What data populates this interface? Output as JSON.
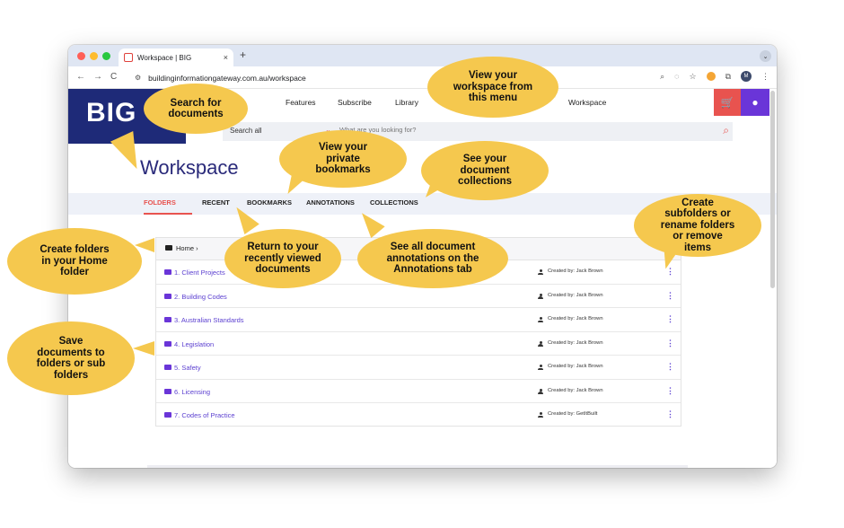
{
  "browser": {
    "tab_title": "Workspace | BIG",
    "tab_close": "×",
    "new_tab": "+",
    "tab_menu": "⌄",
    "nav_back": "←",
    "nav_forward": "→",
    "nav_reload": "C",
    "url": "buildinginformationgateway.com.au/workspace",
    "profile_initial": "M"
  },
  "site": {
    "logo": "BIG",
    "nav": [
      "Features",
      "Subscribe",
      "Library",
      "Workspace"
    ],
    "search": {
      "scope": "Search all",
      "placeholder": "What are you looking for?"
    }
  },
  "workspace": {
    "title": "Workspace",
    "tabs": [
      "FOLDERS",
      "RECENT",
      "BOOKMARKS",
      "ANNOTATIONS",
      "COLLECTIONS"
    ],
    "active_tab": "FOLDERS",
    "breadcrumb": "Home ›",
    "folders": [
      {
        "name": "1. Client Projects",
        "created_by": "Created by: Jack Brown"
      },
      {
        "name": "2. Building Codes",
        "created_by": "Created by: Jack Brown"
      },
      {
        "name": "3. Australian Standards",
        "created_by": "Created by: Jack Brown"
      },
      {
        "name": "4. Legislation",
        "created_by": "Created by: Jack Brown"
      },
      {
        "name": "5. Safety",
        "created_by": "Created by: Jack Brown"
      },
      {
        "name": "6. Licensing",
        "created_by": "Created by: Jack Brown"
      },
      {
        "name": "7. Codes of Practice",
        "created_by": "Created by: GetItBuilt"
      }
    ]
  },
  "callouts": {
    "search": "Search for documents",
    "workspace_menu": "View your workspace from this menu",
    "bookmarks": "View your private bookmarks",
    "collections": "See your document collections",
    "create_folders": "Create folders in your Home folder",
    "recent": "Return to your recently viewed documents",
    "annotations": "See all document annotations on the Annotations tab",
    "subfolders": "Create subfolders or rename folders or remove items",
    "save": "Save documents to folders or sub folders"
  },
  "colors": {
    "brand_navy": "#1e2a78",
    "accent_red": "#e8534f",
    "accent_purple": "#6a35d8",
    "callout_yellow": "#f5c84e"
  }
}
